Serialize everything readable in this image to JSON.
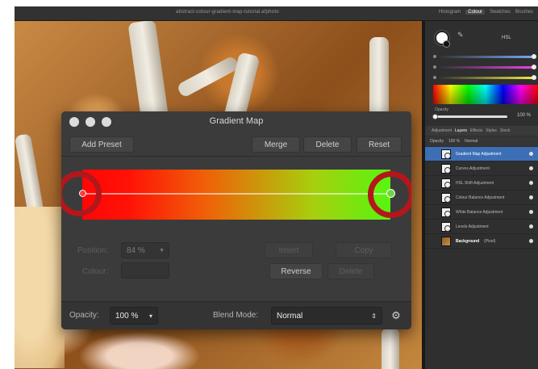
{
  "window": {
    "doc_title": "abstract-colour-gradient-map-tutorial.afphoto",
    "panel_tabs": [
      "Histogram",
      "Colour",
      "Swatches",
      "Brushes"
    ],
    "active_panel_tab": "Colour"
  },
  "color_panel": {
    "hex_value": "HSL",
    "opacity_label": "Opacity",
    "opacity_value": "100 %"
  },
  "layers_panel": {
    "tabs": [
      "Adjustment",
      "Layers",
      "Effects",
      "Styles",
      "Stock"
    ],
    "active_tab": "Layers",
    "options": [
      "Opacity",
      "100 %",
      "Normal"
    ],
    "layers": [
      {
        "name": "Gradient Map Adjustment",
        "selected": true
      },
      {
        "name": "Curves Adjustment",
        "selected": false
      },
      {
        "name": "HSL Shift Adjustment",
        "selected": false
      },
      {
        "name": "Colour Balance Adjustment",
        "selected": false
      },
      {
        "name": "White Balance Adjustment",
        "selected": false
      },
      {
        "name": "Levels Adjustment",
        "selected": false
      },
      {
        "name": "Background",
        "suffix": "(Pixel)",
        "selected": false
      }
    ]
  },
  "dialog": {
    "title": "Gradient Map",
    "toolbar": {
      "add_preset": "Add Preset",
      "merge": "Merge",
      "delete": "Delete",
      "reset": "Reset"
    },
    "gradient": {
      "start_color": "#ff0606",
      "end_color": "#57f50f",
      "annotation_color": "#b3171b"
    },
    "properties": {
      "position_label": "Position:",
      "position_value": "84 %",
      "colour_label": "Colour:",
      "insert": "Insert",
      "copy": "Copy",
      "reverse": "Reverse",
      "delete": "Delete"
    },
    "footer": {
      "opacity_label": "Opacity:",
      "opacity_value": "100 %",
      "blend_label": "Blend Mode:",
      "blend_value": "Normal"
    }
  }
}
